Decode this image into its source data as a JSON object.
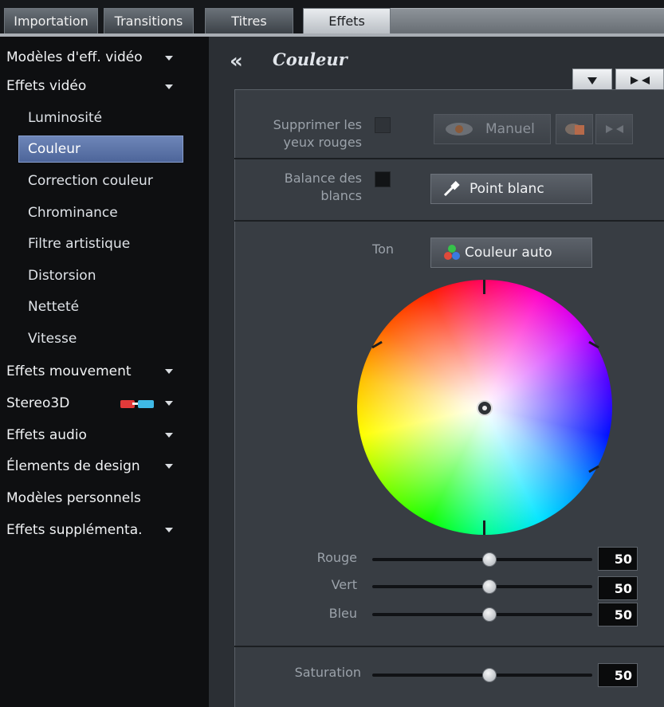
{
  "tabs": [
    {
      "label": "Importation"
    },
    {
      "label": "Transitions"
    },
    {
      "label": "Titres"
    },
    {
      "label": "Effets"
    }
  ],
  "sidebar": {
    "items": [
      {
        "label": "Modèles d'eff. vidéo"
      },
      {
        "label": "Effets vidéo"
      },
      {
        "label": "Luminosité"
      },
      {
        "label": "Couleur"
      },
      {
        "label": "Correction couleur"
      },
      {
        "label": "Chrominance"
      },
      {
        "label": "Filtre artistique"
      },
      {
        "label": "Distorsion"
      },
      {
        "label": "Netteté"
      },
      {
        "label": "Vitesse"
      },
      {
        "label": "Effets mouvement"
      },
      {
        "label": "Stereo3D"
      },
      {
        "label": "Effets audio"
      },
      {
        "label": "Élements de design"
      },
      {
        "label": "Modèles personnels"
      },
      {
        "label": "Effets supplémenta."
      }
    ]
  },
  "header": {
    "title": "Couleur"
  },
  "redeye": {
    "label_line1": "Supprimer les",
    "label_line2": "yeux rouges",
    "button": "Manuel"
  },
  "whitebalance": {
    "label_line1": "Balance des",
    "label_line2": "blancs",
    "button": "Point blanc"
  },
  "tone": {
    "label": "Ton",
    "button": "Couleur auto"
  },
  "sliders": [
    {
      "label": "Rouge",
      "value": "50",
      "fraction": 0.5
    },
    {
      "label": "Vert",
      "value": "50",
      "fraction": 0.5
    },
    {
      "label": "Bleu",
      "value": "50",
      "fraction": 0.5
    },
    {
      "label": "Saturation",
      "value": "50",
      "fraction": 0.5
    }
  ]
}
